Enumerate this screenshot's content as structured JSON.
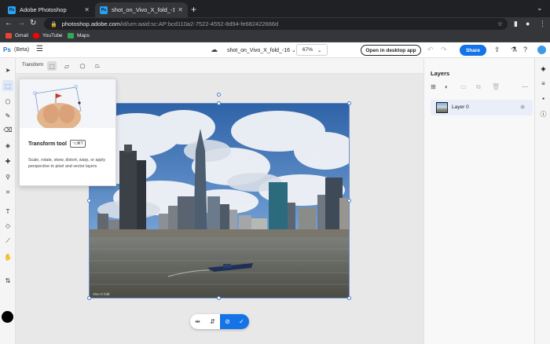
{
  "browser": {
    "tabs": [
      {
        "title": "Adobe Photoshop",
        "favicon": "Ps"
      },
      {
        "title": "shot_on_Vivo_X_fold_-16 - Ad",
        "favicon": "Ps"
      }
    ],
    "url_host": "photoshop.adobe.com",
    "url_path": "/id/urn:aaid:sc:AP:bcd110a2-7522-4552-8d94-fe682422666d",
    "bookmarks": [
      {
        "label": "Gmail",
        "color": "#ea4335"
      },
      {
        "label": "YouTube",
        "color": "#ff0000"
      },
      {
        "label": "Maps",
        "color": "#34a853"
      }
    ]
  },
  "header": {
    "logo": "Ps",
    "beta_label": "(Beta)",
    "doc_name": "shot_on_Vivo_X_fold_-16",
    "zoom": "67%",
    "open_desktop_label": "Open in desktop app",
    "share_label": "Share",
    "accent_color": "#1473e6"
  },
  "options_bar": {
    "label": "Transform"
  },
  "tooltip": {
    "title": "Transform tool",
    "shortcut": "⌥⌘T",
    "description": "Scale, rotate, skew, distort, warp, or apply perspective to pixel and vector layers"
  },
  "canvas": {
    "watermark": "Vivo X fold"
  },
  "layers_panel": {
    "title": "Layers",
    "layers": [
      {
        "name": "Layer 0"
      }
    ]
  }
}
